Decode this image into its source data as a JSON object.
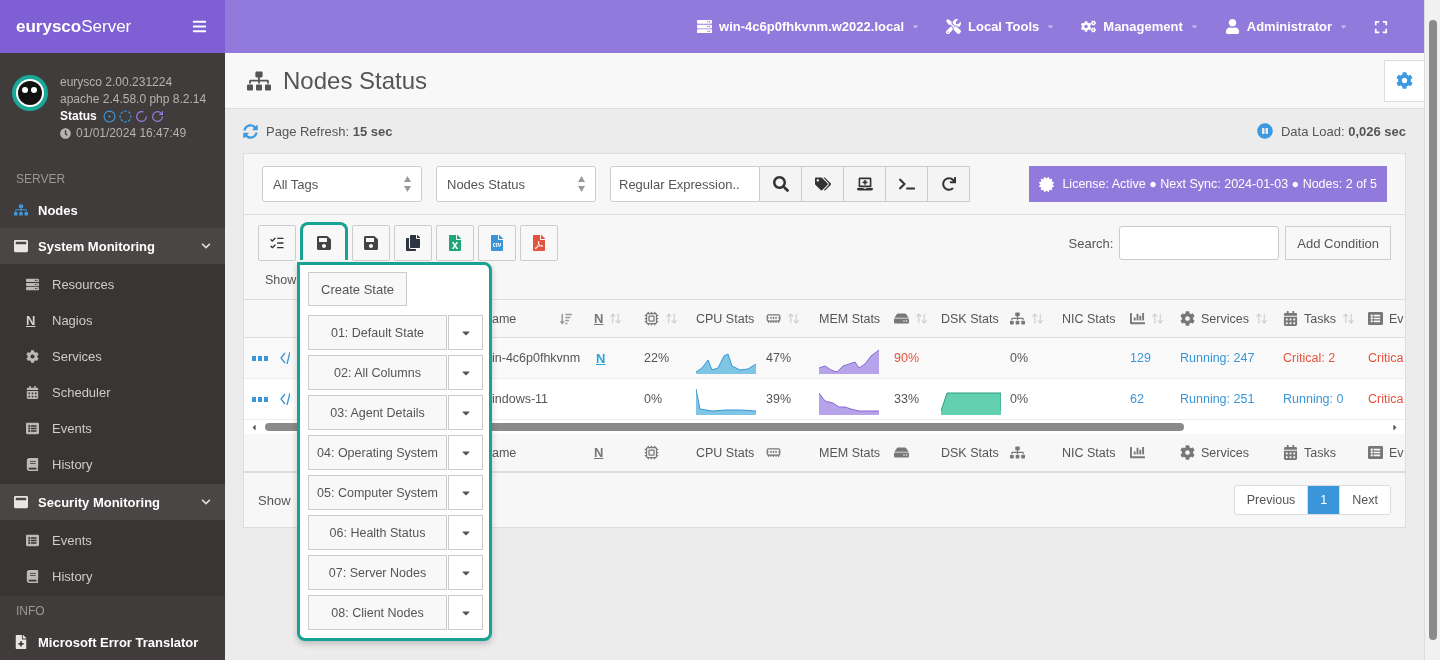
{
  "brand": {
    "bold": "eurysco",
    "rest": "Server"
  },
  "topnav": [
    {
      "label": "win-4c6p0fhkvnm.w2022.local"
    },
    {
      "label": "Local Tools"
    },
    {
      "label": "Management"
    },
    {
      "label": "Administrator"
    }
  ],
  "profile": {
    "version": "eurysco 2.00.231224",
    "stack": "apache 2.4.58.0  php 8.2.14",
    "status_label": "Status",
    "datetime": "01/01/2024 16:47:49"
  },
  "nav": [
    {
      "kind": "heading",
      "label": "SERVER"
    },
    {
      "kind": "link",
      "label": "Nodes",
      "selected": true
    },
    {
      "kind": "group",
      "label": "System Monitoring",
      "expanded": true,
      "children": [
        {
          "label": "Resources",
          "selected": false
        },
        {
          "label": "Nagios",
          "glyph": "N",
          "selected": false
        },
        {
          "label": "Services",
          "selected": false
        },
        {
          "label": "Scheduler",
          "selected": false
        },
        {
          "label": "Events",
          "selected": false
        },
        {
          "label": "History",
          "selected": false
        }
      ]
    },
    {
      "kind": "group",
      "label": "Security Monitoring",
      "expanded": true,
      "children": [
        {
          "label": "Events",
          "selected": false
        },
        {
          "label": "History",
          "selected": false
        }
      ]
    },
    {
      "kind": "heading",
      "label": "INFO"
    },
    {
      "kind": "link",
      "label": "Microsoft Error Translator",
      "selected": false
    }
  ],
  "page": {
    "title": "Nodes Status",
    "refresh": "Page Refresh: **15 sec**",
    "data_load": "Data Load: **0,026 sec**"
  },
  "filters": {
    "tags": "All Tags",
    "view": "Nodes Status",
    "regex_placeholder": "Regular Expression..",
    "license": "License: Active ● Next Sync: 2024-01-03 ● Nodes: 2 of 5"
  },
  "toolbar": {
    "show": "Show",
    "search_label": "Search:",
    "add_condition": "Add Condition"
  },
  "states_menu": {
    "open": true,
    "create": "Create State",
    "states": [
      "01: Default State",
      "02: All Columns",
      "03: Agent Details",
      "04: Operating System",
      "05: Computer System",
      "06: Health Status",
      "07: Server Nodes",
      "08: Client Nodes"
    ]
  },
  "table": {
    "columns": [
      {
        "label": "ame",
        "sortable": true
      },
      {
        "mark": "N",
        "sortable": true
      },
      {
        "sortable": true
      },
      {
        "label": "CPU Stats",
        "sortable": false
      },
      {
        "sortable": true
      },
      {
        "label": "MEM Stats",
        "sortable": false
      },
      {
        "sortable": true
      },
      {
        "label": "DSK Stats",
        "sortable": false
      },
      {
        "sortable": true
      },
      {
        "label": "NIC Stats",
        "sortable": false
      },
      {
        "sortable": true
      },
      {
        "label": "Services",
        "sortable": true
      },
      {
        "label": "Tasks",
        "sortable": true
      },
      {
        "label": "Ev",
        "sortable": false
      }
    ],
    "rows": [
      {
        "name": "in-4c6p0fhkvnm",
        "nagios": "N",
        "cpu": "22%",
        "ram": "47%",
        "disk": {
          "text": "90%",
          "color": "#e5533c"
        },
        "dsk_graph": false,
        "net": "0%",
        "stats": "129",
        "services": {
          "text": "Running: 247",
          "color": "#3a96d8"
        },
        "tasks": {
          "text": "Critical: 2",
          "color": "#e5533c"
        },
        "events": {
          "text": "Critica",
          "color": "#e5533c"
        }
      },
      {
        "name": "indows-11",
        "cpu": "0%",
        "ram": "39%",
        "disk": {
          "text": "33%",
          "color": "#555555"
        },
        "dsk_graph": true,
        "net": "0%",
        "stats": "62",
        "services": {
          "text": "Running: 251",
          "color": "#3a96d8"
        },
        "tasks": {
          "text": "Running: 0",
          "color": "#3a96d8"
        },
        "events": {
          "text": "Critica",
          "color": "#e5533c"
        }
      }
    ],
    "footer_labels": [
      "ame",
      "N",
      "CPU Stats",
      "MEM Stats",
      "DSK Stats",
      "NIC Stats",
      "Services",
      "Tasks",
      "Ev"
    ]
  },
  "footer": {
    "show": "Show",
    "pages": [
      {
        "label": "Previous",
        "selected": false
      },
      {
        "label": "1",
        "selected": true
      },
      {
        "label": "Next",
        "selected": false
      }
    ]
  }
}
